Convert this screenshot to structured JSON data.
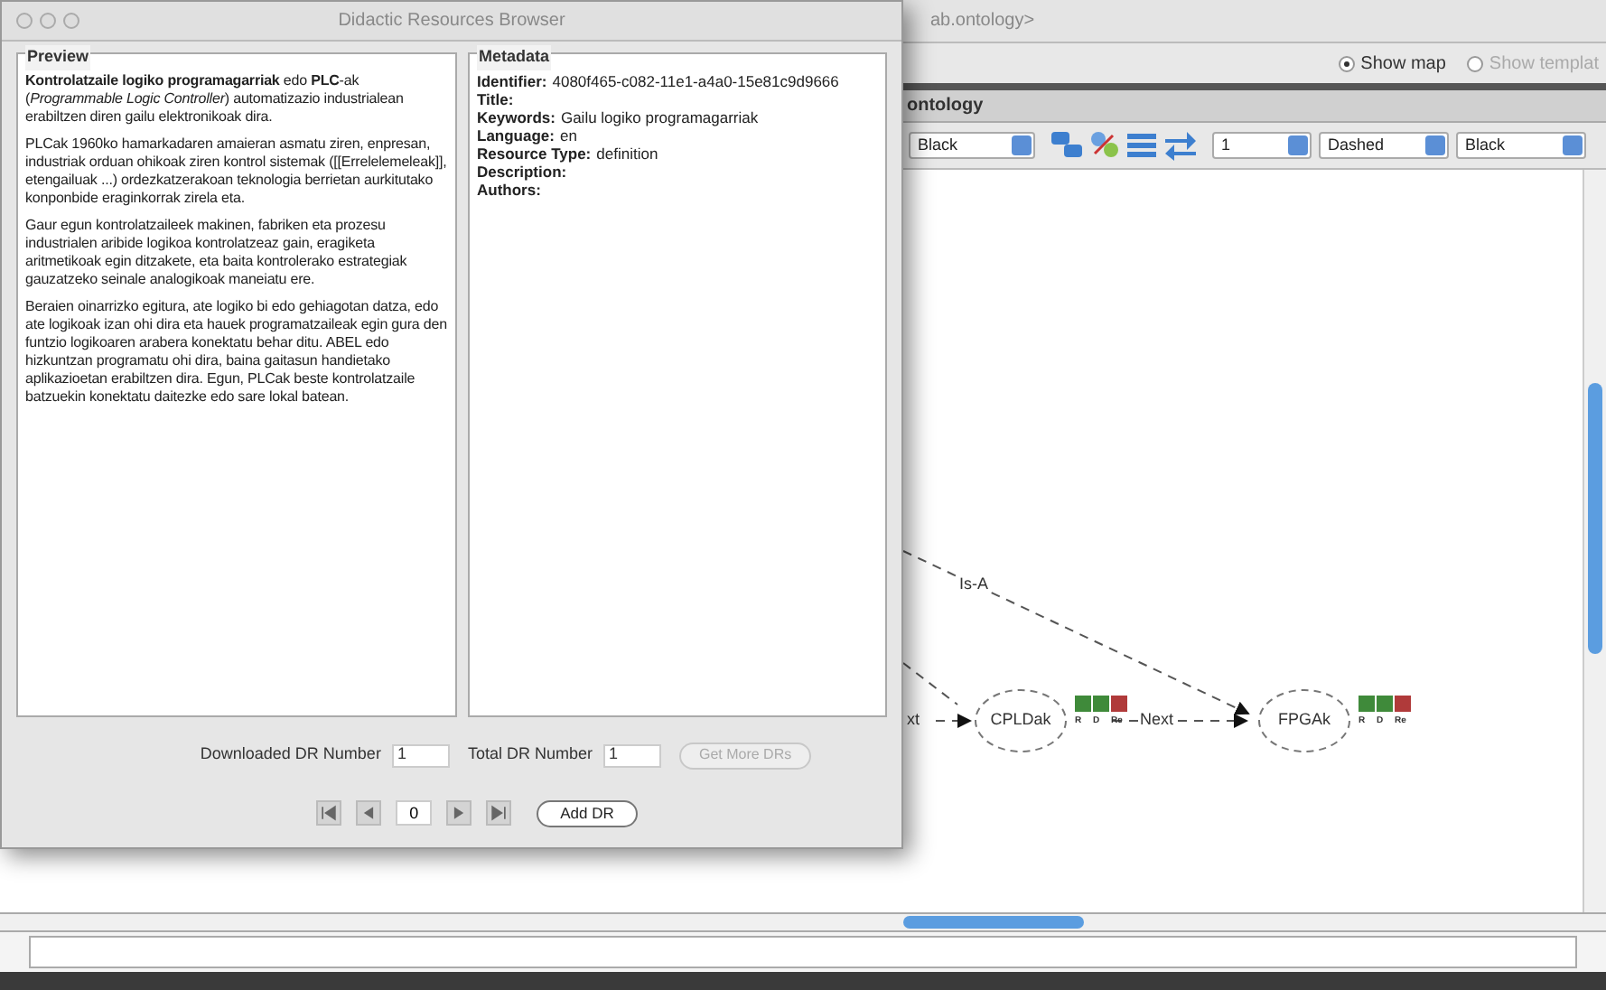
{
  "background_window": {
    "title": "ab.ontology>",
    "view_options": [
      {
        "label": "Show map",
        "selected": true
      },
      {
        "label": "Show templat",
        "selected": false
      }
    ],
    "tab": "ontology",
    "toolbar_selects": [
      "Black",
      "1",
      "Dashed",
      "Black"
    ],
    "diagram": {
      "nodes": [
        {
          "label": "CPLDak",
          "badges": [
            {
              "label": "R",
              "color": "#3f8a3a"
            },
            {
              "label": "D",
              "color": "#3f8a3a"
            },
            {
              "label": "Re",
              "color": "#b03a3a"
            }
          ]
        },
        {
          "label": "FPGAk",
          "badges": [
            {
              "label": "R",
              "color": "#3f8a3a"
            },
            {
              "label": "D",
              "color": "#3f8a3a"
            },
            {
              "label": "Re",
              "color": "#b03a3a"
            }
          ]
        }
      ],
      "edges": [
        {
          "label": "Is-A"
        },
        {
          "label": "xt"
        },
        {
          "label": "Next"
        }
      ]
    }
  },
  "dialog": {
    "title": "Didactic Resources Browser",
    "preview": {
      "heading": "Preview",
      "paragraphs": [
        "**Kontrolatzaile logiko programagarriak** edo **PLC**-ak (*Programmable Logic Controller*) automatizazio industrialean erabiltzen diren gailu elektronikoak dira.",
        "PLCak 1960ko hamarkadaren amaieran asmatu ziren, enpresan, industriak orduan ohikoak ziren kontrol sistemak ([[Errelelemeleak]], etengailuak ...) ordezkatzerakoan teknologia berrietan aurkitutako konponbide eraginkorrak zirela eta.",
        "Gaur egun kontrolatzaileek makinen, fabriken eta prozesu industrialen aribide logikoa kontrolatzeaz gain, eragiketa aritmetikoak egin ditzakete, eta baita kontrolerako estrategiak gauzatzeko seinale analogikoak maneiatu ere.",
        "Beraien oinarrizko egitura, ate logiko bi edo gehiagotan datza, edo  ate logikoak izan ohi dira eta hauek programatzaileak egin gura den funtzio logikoaren arabera konektatu behar ditu. ABEL edo  hizkuntzan programatu ohi dira, baina gaitasun handietako aplikazioetan  erabiltzen dira. Egun, PLCak beste kontrolatzaile batzuekin konektatu daitezke  edo sare lokal batean."
      ]
    },
    "metadata": {
      "heading": "Metadata",
      "fields": [
        {
          "label": "Identifier:",
          "value": "4080f465-c082-11e1-a4a0-15e81c9d9666"
        },
        {
          "label": "Title:"
        },
        {
          "label": "Keywords:",
          "value": "Gailu logiko programagarriak"
        },
        {
          "label": "Language:",
          "value": "en"
        },
        {
          "label": "Resource Type:",
          "value": "definition"
        },
        {
          "label": "Description:"
        },
        {
          "label": "Authors:"
        }
      ]
    },
    "downloaded_label": "Downloaded DR Number",
    "downloaded_value": "1",
    "total_label": "Total DR Number",
    "total_value": "1",
    "get_more_button": {
      "label": "Get More DRs",
      "disabled": true
    },
    "position_value": "0",
    "add_button": {
      "label": "Add DR",
      "disabled": false
    }
  }
}
